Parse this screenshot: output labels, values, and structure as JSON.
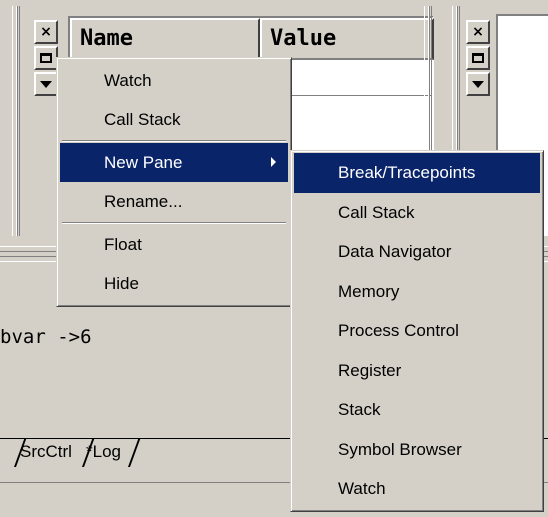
{
  "watch_pane": {
    "col_name": "Name",
    "col_value": "Value"
  },
  "context_menu": {
    "items": [
      {
        "label": "Watch"
      },
      {
        "label": "Call Stack"
      },
      {
        "label": "New Pane",
        "has_submenu": true,
        "selected": true
      },
      {
        "label": "Rename..."
      },
      {
        "label": "Float"
      },
      {
        "label": "Hide"
      }
    ]
  },
  "submenu": {
    "items": [
      {
        "label": "Break/Tracepoints",
        "selected": true
      },
      {
        "label": "Call Stack"
      },
      {
        "label": "Data Navigator"
      },
      {
        "label": "Memory"
      },
      {
        "label": "Process Control"
      },
      {
        "label": "Register"
      },
      {
        "label": "Stack"
      },
      {
        "label": "Symbol Browser"
      },
      {
        "label": "Watch"
      }
    ]
  },
  "output": {
    "line": "bvar ->6"
  },
  "tabs": [
    {
      "label": "SrcCtrl"
    },
    {
      "label": "*Log"
    }
  ],
  "icons": {
    "close": "close-icon",
    "restore": "restore-icon",
    "dropdown": "dropdown-icon",
    "submenu_arrow": "chevron-right-icon"
  },
  "colors": {
    "face": "#d4d0c8",
    "highlight": "#0a246a",
    "highlight_text": "#ffffff"
  }
}
